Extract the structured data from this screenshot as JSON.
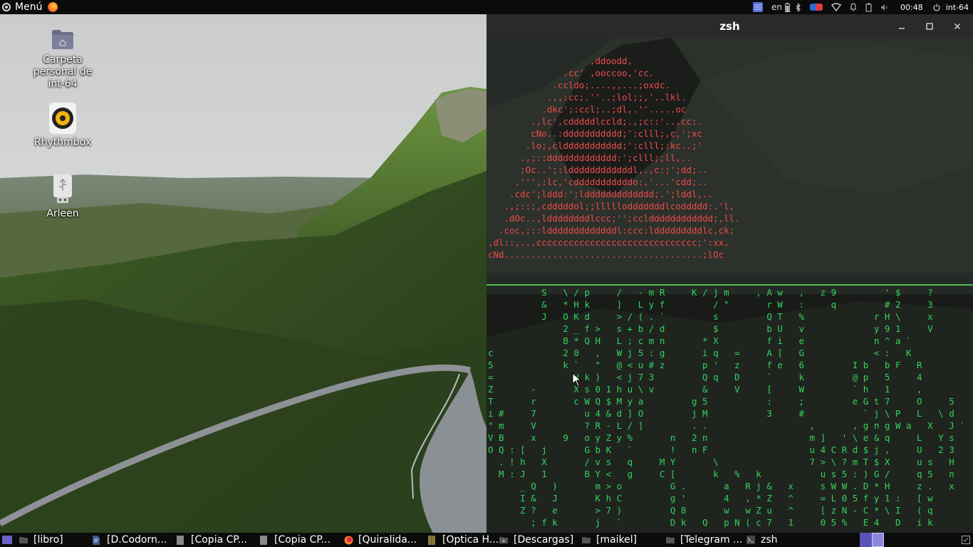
{
  "top_panel": {
    "menu_label": "Menú",
    "keyboard_layout": "en",
    "clock": "00:48",
    "username": "int-64"
  },
  "desktop": {
    "icons": [
      {
        "label": "Carpeta personal de int-64",
        "icon": "home-folder-icon"
      },
      {
        "label": "Rhythmbox",
        "icon": "rhythmbox-icon"
      },
      {
        "label": "Arleen",
        "icon": "usb-drive-icon"
      }
    ]
  },
  "terminal": {
    "title": "zsh",
    "logo_ascii": [
      "                   ,ddoodd,",
      "              .cc' ,ooccoo,'cc.",
      "            .ccldo;....,,...;oxdc.",
      "           .,,:cc;.''..;lol;;,'..lkl.",
      "          .dkc';:ccl;..;dl,.''.....oc",
      "        .,lc',cdddddlccld;.,;c::'..,cc:.",
      "        cNo..:ddddddddddd;':clll;,c,';xc",
      "       .lo;,clddddddddddd;':clll;:kc..;'",
      "      .,;::ddddddddddddd:';clll;;ll,..",
      "      ;Oc..';:lddddddddddddl,.,c:;';dd;..",
      "     .''',:lc,'cdddddddddddo:,'...'cdd;..",
      "    .cdc';lddd:';lddddddddddddd;.';lddl,..",
      "   .,;::;,cdddddol;;lllllodddddddlcoddddd:.'l,",
      "   .dOc..,lddddddddlccc;'';ccldddddddddddd;,ll.",
      "  .coc,;::ldddddddddddddl:ccc:ldddddddddlc,ck;",
      ",dl::,..,cccccccccccccccccccccccccccccc;':xx,",
      "cNd.....................................;lOc"
    ],
    "matrix_rain": [
      "          S   \\ / p     /   - m R     K / j m     , A w   ,   z 9         ' $     ?",
      "          &   * H k     ]   L y f         / \"       r W   :     q         # 2     3",
      "          J   O K d     > / ( . `         s         Q T   %             r H \\     x",
      "              2 _ f >   s + b / d         $         b U   v             y 9 1     V",
      "              B * Q H   L ; c m n       * X         f i   e             n ^ a `",
      "c             2 0   ,   W j 5 : g       i q   =     A [   G             < :   K",
      "5             k `   \"   @ < u # z       p '   z     f e   6         I b   b F   R",
      "=               H k )   < j 7 3         Q q   D     `     k         @ p   5     4",
      "Z       -       X s 0 1 h u \\ v         &     V     [     W         ` h   1     ,",
      "T       r       c W Q $ M y a         g 5           :     ;         e G t 7     O     5",
      "i #     7         u 4 & d ] O         j M           3     #           ` j \\ P   L   \\ d",
      "\" m     V         ? R - L / ]         . .                   ,       , g n g W a   X   J `",
      "V B     x     9   o y Z y %       n   2 n                   m ]   ' \\ e & q     L   Y s",
      "O Q : [   j       G b K   `       !   n F                   u 4 C R d $ j ,     U   2 3",
      "  . ! h   X       / v s   q     M Y       \\                 7 > \\ ? m T $ X     u s   H",
      "  M : J   1       B Y <   g     C [       k   %   k           u s 5 : ) G /     q 5   n",
      "      _ Q   )       m > o         G .       a   R j &   x     s W W . D * H     z .   x",
      "      I &   J       K h C         g '       4   , * Z   ^     = L 0 5 f y 1 :   [ w",
      "      Z ?   e       > 7 )         Q 8       w   w Z u   ^     [ z N - C * \\ I   ( q",
      "        ; f k       j   `         D k   Q   p N ( c 7   1     0 5 %   E 4   D   i k"
    ]
  },
  "taskbar": {
    "tasks": [
      {
        "label": "[libro]",
        "icon": "folder-icon"
      },
      {
        "label": "[D.Codorn...",
        "icon": "document-icon"
      },
      {
        "label": "[Copia CP...",
        "icon": "text-file-icon"
      },
      {
        "label": "[Copia CP...",
        "icon": "text-file-icon"
      },
      {
        "label": "[Quiralida...",
        "icon": "firefox-icon"
      },
      {
        "label": "[Optica H...",
        "icon": "archive-icon"
      },
      {
        "label": "[Descargas]",
        "icon": "downloads-folder-icon"
      },
      {
        "label": "[maikel]",
        "icon": "folder-icon"
      },
      {
        "label": "[Telegram ...",
        "icon": "folder-icon"
      },
      {
        "label": "zsh",
        "icon": "terminal-icon"
      }
    ]
  },
  "colors": {
    "panel_bg": "#0b0b0b",
    "terminal_logo": "#ee4b4b",
    "matrix_green": "#2fd65a",
    "workspace_active": "#7b6fd8"
  }
}
